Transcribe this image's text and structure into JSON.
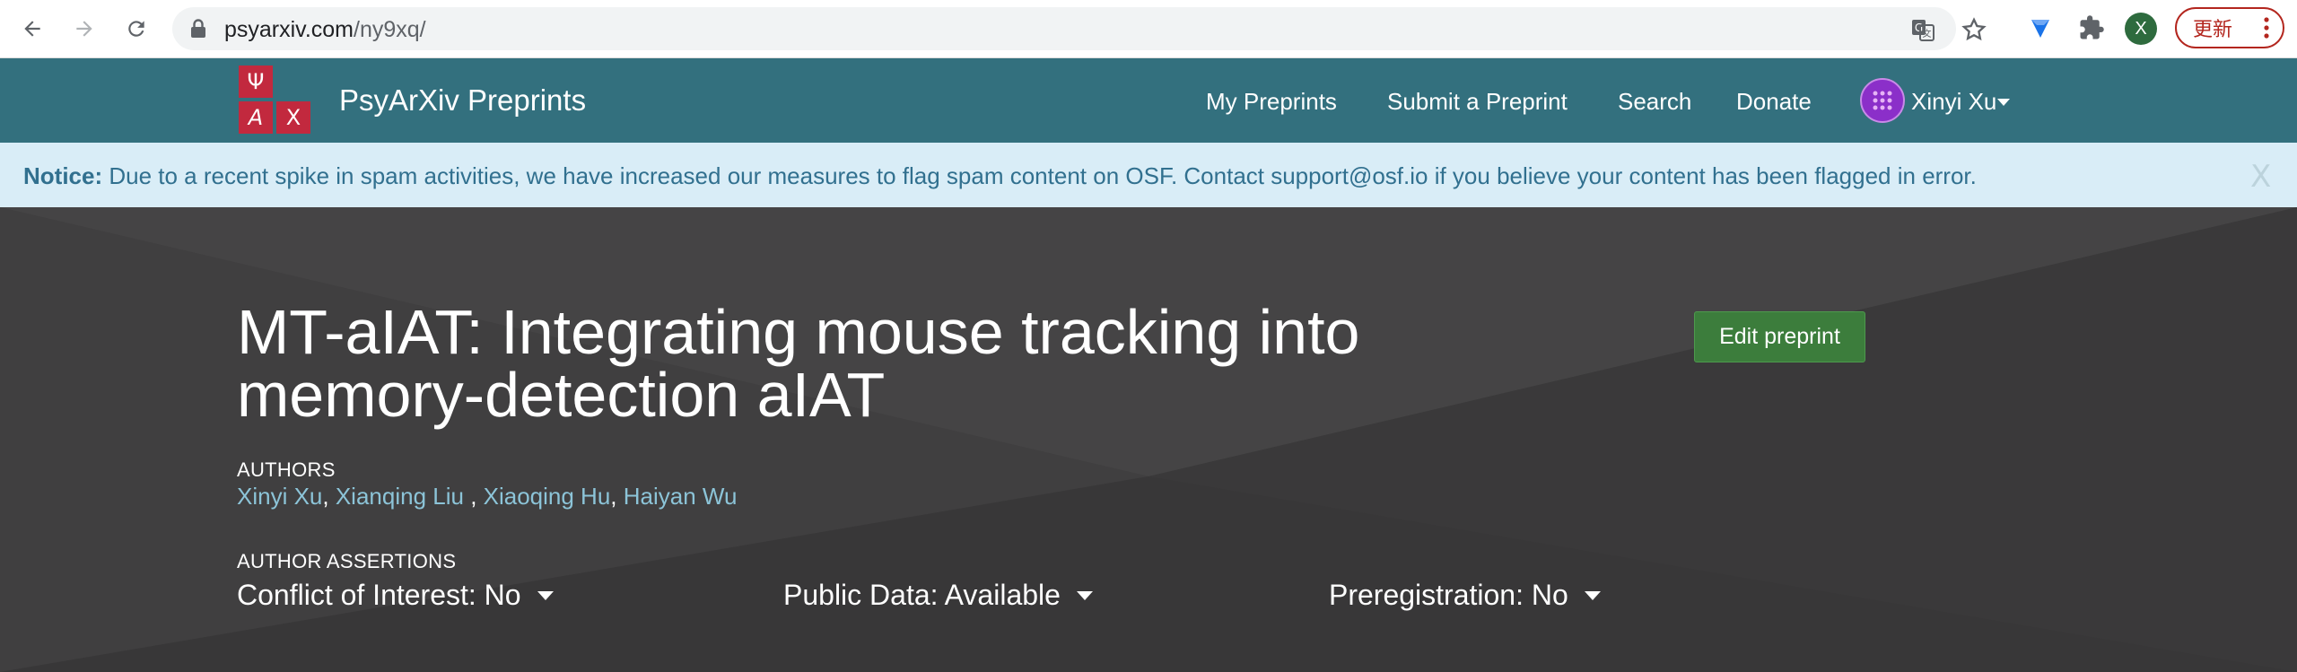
{
  "browser": {
    "url_host": "psyarxiv.com",
    "url_path": "/ny9xq/",
    "profile_initial": "X",
    "update_label": "更新"
  },
  "navbar": {
    "brand": "PsyArXiv Preprints",
    "logo_letters": [
      "Ψ",
      "A",
      "X"
    ],
    "links": [
      "My Preprints",
      "Submit a Preprint",
      "Search",
      "Donate"
    ],
    "user_name": "Xinyi Xu"
  },
  "notice": {
    "label": "Notice:",
    "text": " Due to a recent spike in spam activities, we have increased our measures to flag spam content on OSF. Contact support@osf.io if you believe your content has been flagged in error.",
    "close": "X"
  },
  "preprint": {
    "title": "MT-aIAT: Integrating mouse tracking into memory-detection aIAT",
    "edit_label": "Edit preprint",
    "authors_label": "AUTHORS",
    "authors": [
      "Xinyi Xu",
      "Xianqing Liu",
      "Xiaoqing Hu",
      "Haiyan Wu"
    ],
    "assertions_label": "AUTHOR ASSERTIONS",
    "assertions": [
      "Conflict of Interest: No",
      "Public Data: Available",
      "Preregistration: No"
    ]
  },
  "colors": {
    "navbar": "#33707e",
    "notice_bg": "#d9edf7",
    "hero_bg": "#3e3d3e",
    "edit_button": "#3c7d3c",
    "author_link": "#8cc4d8",
    "logo_red": "#c2293e"
  }
}
